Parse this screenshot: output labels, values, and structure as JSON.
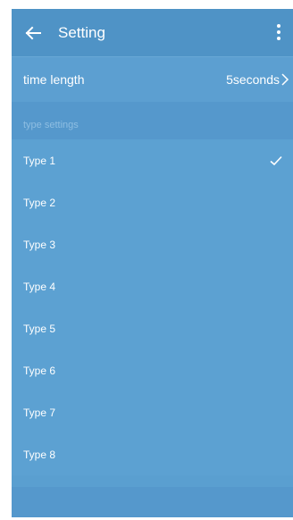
{
  "header": {
    "title": "Setting",
    "back_icon": "arrow-left-icon",
    "menu_icon": "more-vert-icon"
  },
  "time_length": {
    "label": "time length",
    "value": "5seconds",
    "icon": "chevron-right-icon"
  },
  "type_settings": {
    "section_label": "type settings",
    "items": [
      {
        "label": "Type 1",
        "selected": true
      },
      {
        "label": "Type 2",
        "selected": false
      },
      {
        "label": "Type 3",
        "selected": false
      },
      {
        "label": "Type 4",
        "selected": false
      },
      {
        "label": "Type 5",
        "selected": false
      },
      {
        "label": "Type 6",
        "selected": false
      },
      {
        "label": "Type 7",
        "selected": false
      },
      {
        "label": "Type 8",
        "selected": false
      }
    ]
  },
  "colors": {
    "appbar": "#4f93c6",
    "list_bg": "#5ca1d2",
    "section_bg": "#5598cc",
    "text": "#ffffff",
    "section_text": "#8ebee2"
  }
}
